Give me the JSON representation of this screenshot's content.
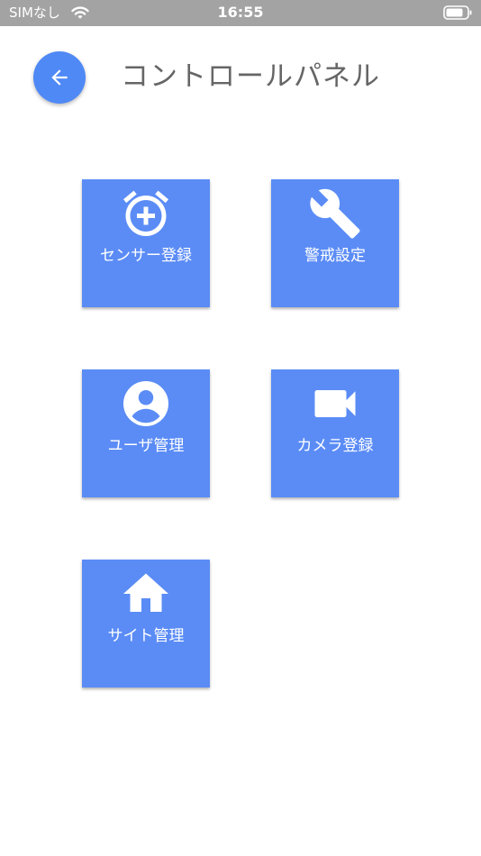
{
  "status_bar": {
    "carrier": "SIMなし",
    "time": "16:55",
    "wifi_icon": "wifi-icon",
    "battery_icon": "battery-icon"
  },
  "header": {
    "back_icon": "arrow-left-icon",
    "title": "コントロールパネル"
  },
  "menu": {
    "items": [
      {
        "label": "センサー登録",
        "icon": "alarm-add-icon"
      },
      {
        "label": "警戒設定",
        "icon": "wrench-icon"
      },
      {
        "label": "ユーザ管理",
        "icon": "account-circle-icon"
      },
      {
        "label": "カメラ登録",
        "icon": "video-camera-icon"
      },
      {
        "label": "サイト管理",
        "icon": "home-icon"
      }
    ]
  },
  "colors": {
    "status_bar": "#a3a3a3",
    "accent": "#4f89f6",
    "tile": "#5b8cf6",
    "title_text": "#666666"
  }
}
